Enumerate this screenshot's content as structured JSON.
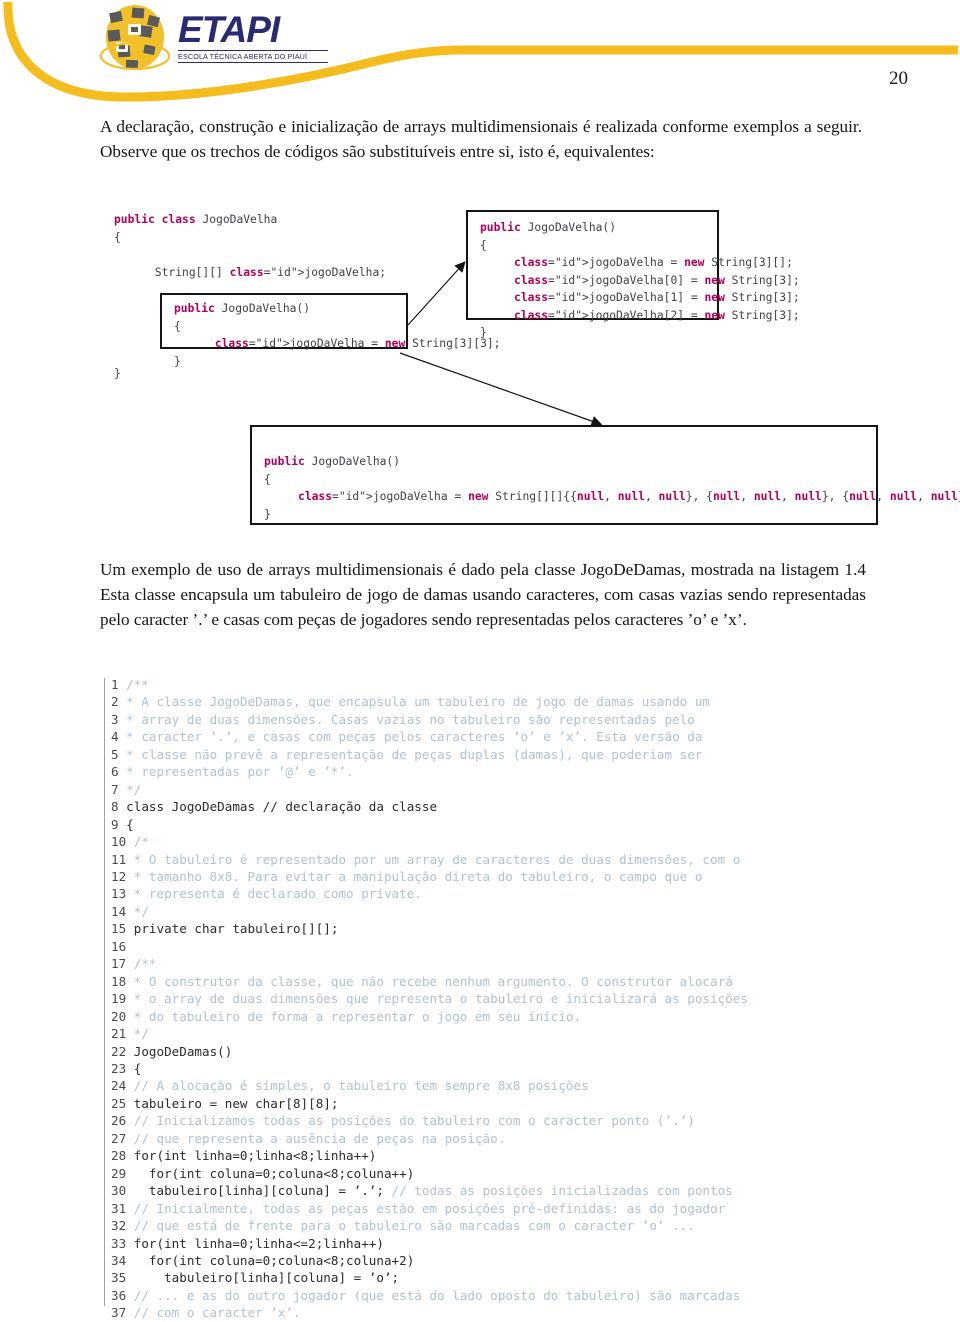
{
  "header": {
    "logo_text": "ETAPI",
    "logo_subtitle": "ESCOLA TÉCNICA ABERTA DO PIAUÍ",
    "page_number": "20",
    "accent_color": "#f5bc1e",
    "logo_color": "#2a2a72"
  },
  "paragraphs": {
    "intro": "A declaração, construção e inicialização de arrays multidimensionais é realizada conforme exemplos a seguir. Observe que os trechos de códigos são substituíveis entre si, isto é, equivalentes:",
    "damas": "Um exemplo de uso de arrays multidimensionais é dado pela classe JogoDeDamas, mostrada na listagem 1.4 Esta classe encapsula um tabuleiro de jogo de damas usando caracteres, com casas vazias sendo representadas pelo caracter ’.’ e casas com peças de jogadores sendo representadas pelos caracteres ’o’ e ’x’."
  },
  "diagram": {
    "outer_class_header": "public class JogoDaVelha\n{\n\n      String[][] jogoDaVelha;",
    "outer_class_close": "}",
    "box_left": "public JogoDaVelha()\n{\n      jogoDaVelha = new String[3][3];\n}",
    "box_right": "public JogoDaVelha()\n{\n     jogoDaVelha = new String[3][];\n     jogoDaVelha[0] = new String[3];\n     jogoDaVelha[1] = new String[3];\n     jogoDaVelha[2] = new String[3];\n}",
    "box_bottom": "public JogoDaVelha()\n{\n     jogoDaVelha = new String[][]{{null, null, null}, {null, null, null}, {null, null, null}};\n}"
  },
  "listing": {
    "lines": [
      {
        "no": "1",
        "text": "/**",
        "kind": "cmt"
      },
      {
        "no": "2",
        "text": "* A classe JogoDeDamas, que encapsula um tabuleiro de jogo de damas usando um",
        "kind": "cmt"
      },
      {
        "no": "3",
        "text": "* array de duas dimensões. Casas vazias no tabuleiro são representadas pelo",
        "kind": "cmt"
      },
      {
        "no": "4",
        "text": "* caracter ’.’, e casas com peças pelos caracteres ’o’ e ’x’. Esta versão da",
        "kind": "cmt"
      },
      {
        "no": "5",
        "text": "* classe não prevê a representação de peças duplas (damas), que poderiam ser",
        "kind": "cmt"
      },
      {
        "no": "6",
        "text": "* representadas por ’@’ e ’*’.",
        "kind": "cmt"
      },
      {
        "no": "7",
        "text": "*/",
        "kind": "cmt"
      },
      {
        "no": "8",
        "text": "class JogoDeDamas // declaração da classe",
        "kind": "src"
      },
      {
        "no": "9",
        "text": "{",
        "kind": "src"
      },
      {
        "no": "10",
        "text": "/*",
        "kind": "cmt"
      },
      {
        "no": "11",
        "text": "* O tabuleiro é representado por um array de caracteres de duas dimensões, com o",
        "kind": "cmt"
      },
      {
        "no": "12",
        "text": "* tamanho 8x8. Para evitar a manipulação direta do tabuleiro, o campo que o",
        "kind": "cmt"
      },
      {
        "no": "13",
        "text": "* representa é declarado como private.",
        "kind": "cmt"
      },
      {
        "no": "14",
        "text": "*/",
        "kind": "cmt"
      },
      {
        "no": "15",
        "text": "private char tabuleiro[][];",
        "kind": "src"
      },
      {
        "no": "16",
        "text": "",
        "kind": "src"
      },
      {
        "no": "17",
        "text": "/**",
        "kind": "cmt"
      },
      {
        "no": "18",
        "text": "* O construtor da classe, que não recebe nenhum argumento. O construtor alocará",
        "kind": "cmt"
      },
      {
        "no": "19",
        "text": "* o array de duas dimensões que representa o tabuleiro e inicializará as posições",
        "kind": "cmt"
      },
      {
        "no": "20",
        "text": "* do tabuleiro de forma a representar o jogo em seu início.",
        "kind": "cmt"
      },
      {
        "no": "21",
        "text": "*/",
        "kind": "cmt"
      },
      {
        "no": "22",
        "text": "JogoDeDamas()",
        "kind": "src"
      },
      {
        "no": "23",
        "text": "{",
        "kind": "src"
      },
      {
        "no": "24",
        "text": "// A alocação é simples, o tabuleiro tem sempre 8x8 posições",
        "kind": "cmt"
      },
      {
        "no": "25",
        "text": "tabuleiro = new char[8][8];",
        "kind": "src"
      },
      {
        "no": "26",
        "text": "// Inicializamos todas as posições do tabuleiro com o caracter ponto (’.’)",
        "kind": "cmt"
      },
      {
        "no": "27",
        "text": "// que representa a ausência de peças na posição.",
        "kind": "cmt"
      },
      {
        "no": "28",
        "text": "for(int linha=0;linha<8;linha++)",
        "kind": "src"
      },
      {
        "no": "29",
        "text": "  for(int coluna=0;coluna<8;coluna++)",
        "kind": "src"
      },
      {
        "no": "30",
        "text": "  tabuleiro[linha][coluna] = ’.’;",
        "kind": "src",
        "trail": " // todas as posições inicializadas com pontos"
      },
      {
        "no": "31",
        "text": "// Inicialmente, todas as peças estão em posições pré-definidas: as do jogador",
        "kind": "cmt"
      },
      {
        "no": "32",
        "text": "// que está de frente para o tabuleiro são marcadas com o caracter ’o’ ...",
        "kind": "cmt"
      },
      {
        "no": "33",
        "text": "for(int linha=0;linha<=2;linha++)",
        "kind": "src"
      },
      {
        "no": "34",
        "text": "  for(int coluna=0;coluna<8;coluna+2)",
        "kind": "src"
      },
      {
        "no": "35",
        "text": "    tabuleiro[linha][coluna] = ’o’;",
        "kind": "src"
      },
      {
        "no": "36",
        "text": "// ... e as do outro jogador (que está do lado oposto do tabuleiro) são marcadas",
        "kind": "cmt"
      },
      {
        "no": "37",
        "text": "// com o caracter ’x’.",
        "kind": "cmt"
      }
    ]
  }
}
